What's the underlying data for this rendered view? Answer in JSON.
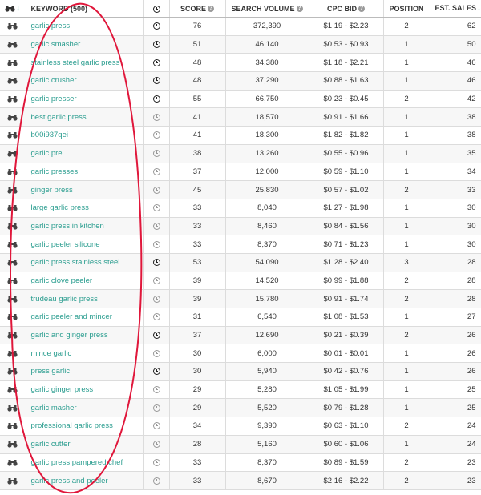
{
  "header": {
    "keyword_label": "KEYWORD (500)",
    "score_label": "SCORE",
    "search_volume_label": "SEARCH VOLUME",
    "cpc_bid_label": "CPC BID",
    "position_label": "POSITION",
    "est_sales_label": "EST. SALES",
    "help_glyph": "?",
    "sort_glyph": "↓"
  },
  "rows": [
    {
      "keyword": "garlic press",
      "clock": "dark",
      "score": "76",
      "volume": "372,390",
      "cpc": "$1.19 - $2.23",
      "position": "2",
      "sales": "62"
    },
    {
      "keyword": "garlic smasher",
      "clock": "dark",
      "score": "51",
      "volume": "46,140",
      "cpc": "$0.53 - $0.93",
      "position": "1",
      "sales": "50"
    },
    {
      "keyword": "stainless steel garlic press",
      "clock": "dark",
      "score": "48",
      "volume": "34,380",
      "cpc": "$1.18 - $2.21",
      "position": "1",
      "sales": "46"
    },
    {
      "keyword": "garlic crusher",
      "clock": "dark",
      "score": "48",
      "volume": "37,290",
      "cpc": "$0.88 - $1.63",
      "position": "1",
      "sales": "46"
    },
    {
      "keyword": "garlic presser",
      "clock": "dark",
      "score": "55",
      "volume": "66,750",
      "cpc": "$0.23 - $0.45",
      "position": "2",
      "sales": "42"
    },
    {
      "keyword": "best garlic press",
      "clock": "faint",
      "score": "41",
      "volume": "18,570",
      "cpc": "$0.91 - $1.66",
      "position": "1",
      "sales": "38"
    },
    {
      "keyword": "b00i937qei",
      "clock": "faint",
      "score": "41",
      "volume": "18,300",
      "cpc": "$1.82 - $1.82",
      "position": "1",
      "sales": "38"
    },
    {
      "keyword": "garlic pre",
      "clock": "faint",
      "score": "38",
      "volume": "13,260",
      "cpc": "$0.55 - $0.96",
      "position": "1",
      "sales": "35"
    },
    {
      "keyword": "garlic presses",
      "clock": "faint",
      "score": "37",
      "volume": "12,000",
      "cpc": "$0.59 - $1.10",
      "position": "1",
      "sales": "34"
    },
    {
      "keyword": "ginger press",
      "clock": "faint",
      "score": "45",
      "volume": "25,830",
      "cpc": "$0.57 - $1.02",
      "position": "2",
      "sales": "33"
    },
    {
      "keyword": "large garlic press",
      "clock": "faint",
      "score": "33",
      "volume": "8,040",
      "cpc": "$1.27 - $1.98",
      "position": "1",
      "sales": "30"
    },
    {
      "keyword": "garlic press in kitchen",
      "clock": "faint",
      "score": "33",
      "volume": "8,460",
      "cpc": "$0.84 - $1.56",
      "position": "1",
      "sales": "30"
    },
    {
      "keyword": "garlic peeler silicone",
      "clock": "faint",
      "score": "33",
      "volume": "8,370",
      "cpc": "$0.71 - $1.23",
      "position": "1",
      "sales": "30"
    },
    {
      "keyword": "garlic press stainless steel",
      "clock": "dark",
      "score": "53",
      "volume": "54,090",
      "cpc": "$1.28 - $2.40",
      "position": "3",
      "sales": "28"
    },
    {
      "keyword": "garlic clove peeler",
      "clock": "faint",
      "score": "39",
      "volume": "14,520",
      "cpc": "$0.99 - $1.88",
      "position": "2",
      "sales": "28"
    },
    {
      "keyword": "trudeau garlic press",
      "clock": "faint",
      "score": "39",
      "volume": "15,780",
      "cpc": "$0.91 - $1.74",
      "position": "2",
      "sales": "28"
    },
    {
      "keyword": "garlic peeler and mincer",
      "clock": "faint",
      "score": "31",
      "volume": "6,540",
      "cpc": "$1.08 - $1.53",
      "position": "1",
      "sales": "27"
    },
    {
      "keyword": "garlic and ginger press",
      "clock": "dark",
      "score": "37",
      "volume": "12,690",
      "cpc": "$0.21 - $0.39",
      "position": "2",
      "sales": "26"
    },
    {
      "keyword": "mince garlic",
      "clock": "faint",
      "score": "30",
      "volume": "6,000",
      "cpc": "$0.01 - $0.01",
      "position": "1",
      "sales": "26"
    },
    {
      "keyword": "press garlic",
      "clock": "dark",
      "score": "30",
      "volume": "5,940",
      "cpc": "$0.42 - $0.76",
      "position": "1",
      "sales": "26"
    },
    {
      "keyword": "garlic ginger press",
      "clock": "faint",
      "score": "29",
      "volume": "5,280",
      "cpc": "$1.05 - $1.99",
      "position": "1",
      "sales": "25"
    },
    {
      "keyword": "garlic masher",
      "clock": "faint",
      "score": "29",
      "volume": "5,520",
      "cpc": "$0.79 - $1.28",
      "position": "1",
      "sales": "25"
    },
    {
      "keyword": "professional garlic press",
      "clock": "faint",
      "score": "34",
      "volume": "9,390",
      "cpc": "$0.63 - $1.10",
      "position": "2",
      "sales": "24"
    },
    {
      "keyword": "garlic cutter",
      "clock": "faint",
      "score": "28",
      "volume": "5,160",
      "cpc": "$0.60 - $1.06",
      "position": "1",
      "sales": "24"
    },
    {
      "keyword": "garlic press pampered chef",
      "clock": "faint",
      "score": "33",
      "volume": "8,370",
      "cpc": "$0.89 - $1.59",
      "position": "2",
      "sales": "23"
    },
    {
      "keyword": "garlic press and peeler",
      "clock": "faint",
      "score": "33",
      "volume": "8,670",
      "cpc": "$2.16 - $2.22",
      "position": "2",
      "sales": "23"
    }
  ],
  "annotation": {
    "shape": "hand-drawn oval",
    "color": "#e0173b"
  },
  "colors": {
    "keyword_link": "#2a9d8f",
    "row_alt": "#f7f7f7",
    "grid": "#dcdcdc"
  },
  "icons": {
    "row_action": "binoculars-icon",
    "history": "clock-icon",
    "help": "help-circle-icon"
  }
}
